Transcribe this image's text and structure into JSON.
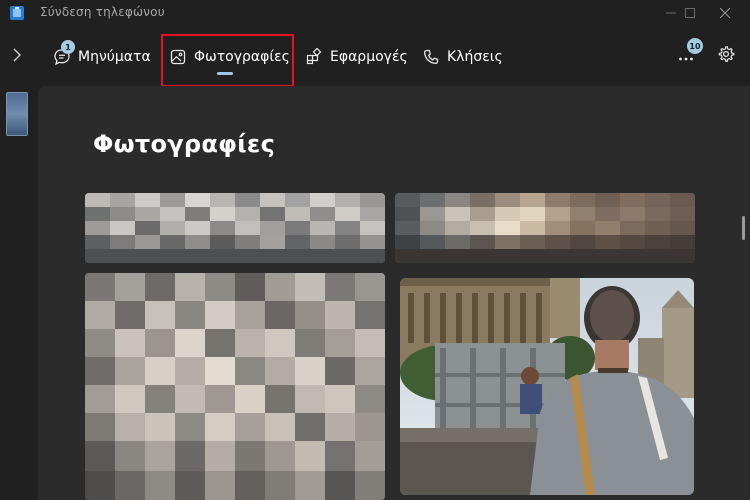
{
  "window": {
    "title": "Σύνδεση τηλεφώνου",
    "controls": [
      "minimize-icon",
      "maximize-icon",
      "close-icon"
    ]
  },
  "nav": {
    "tabs": [
      {
        "label": "Μηνύματα",
        "icon": "chat-icon",
        "badge": "1"
      },
      {
        "label": "Φωτογραφίες",
        "icon": "photo-icon",
        "selected": true
      },
      {
        "label": "Εφαρμογές",
        "icon": "apps-icon"
      },
      {
        "label": "Κλήσεις",
        "icon": "phone-icon"
      }
    ],
    "more_badge": "10",
    "icons": [
      "chevron-right-icon",
      "more-icon",
      "gear-icon"
    ]
  },
  "main": {
    "heading": "Φωτογραφίες"
  },
  "colors": {
    "background": "#202020",
    "content": "#2b2b2b",
    "accent": "#9fc7e6",
    "highlight": "#e81123",
    "badge": "#a6cbe0"
  }
}
